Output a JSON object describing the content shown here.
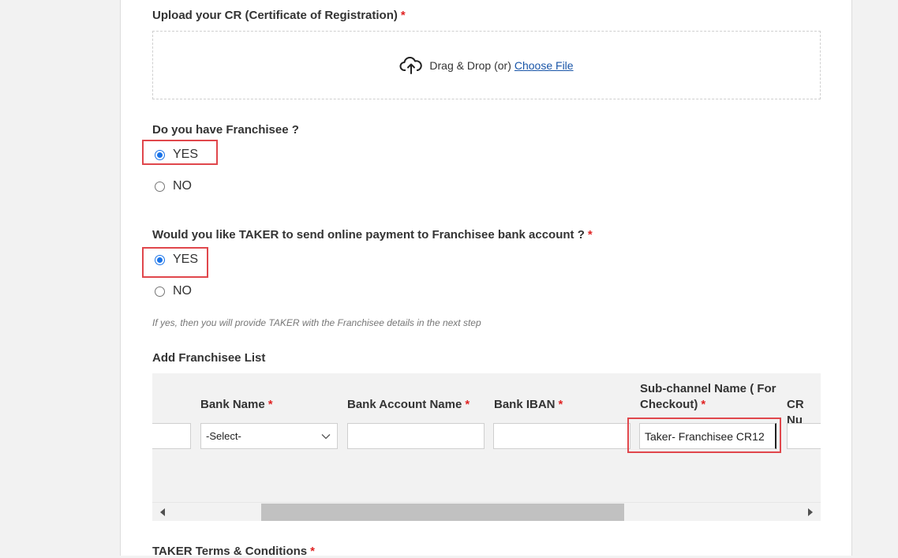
{
  "upload": {
    "label": "Upload your CR (Certificate of Registration)",
    "required_mark": "*",
    "drag_text": "Drag & Drop (or)",
    "choose_file": "Choose File",
    "icon": "cloud-upload-icon"
  },
  "franchisee_q": {
    "label": "Do you have Franchisee ?",
    "options": [
      {
        "label": "YES",
        "checked": true
      },
      {
        "label": "NO",
        "checked": false
      }
    ]
  },
  "payment_q": {
    "label": "Would you like TAKER to send online payment to Franchisee bank account ?",
    "required_mark": "*",
    "options": [
      {
        "label": "YES",
        "checked": true
      },
      {
        "label": "NO",
        "checked": false
      }
    ],
    "hint": "If yes, then you will provide TAKER with the Franchisee details in the next step"
  },
  "franchisee_list": {
    "title": "Add Franchisee List",
    "columns": {
      "bank_name": "Bank Name",
      "bank_account_name": "Bank Account Name",
      "bank_iban": "Bank IBAN",
      "sub_channel_line1": "Sub-channel Name ( For",
      "sub_channel_line2": "Checkout)",
      "cr_number": "CR Nu",
      "required_mark": "*"
    },
    "row": {
      "bank_name_value": "-Select-",
      "sub_channel_value": "Taker- Franchisee CR12"
    }
  },
  "terms": {
    "label": "TAKER Terms & Conditions",
    "required_mark": "*"
  },
  "colors": {
    "accent": "#1a73e8",
    "required": "#e02424",
    "highlight": "#e0474c",
    "link": "#1a56a8"
  }
}
